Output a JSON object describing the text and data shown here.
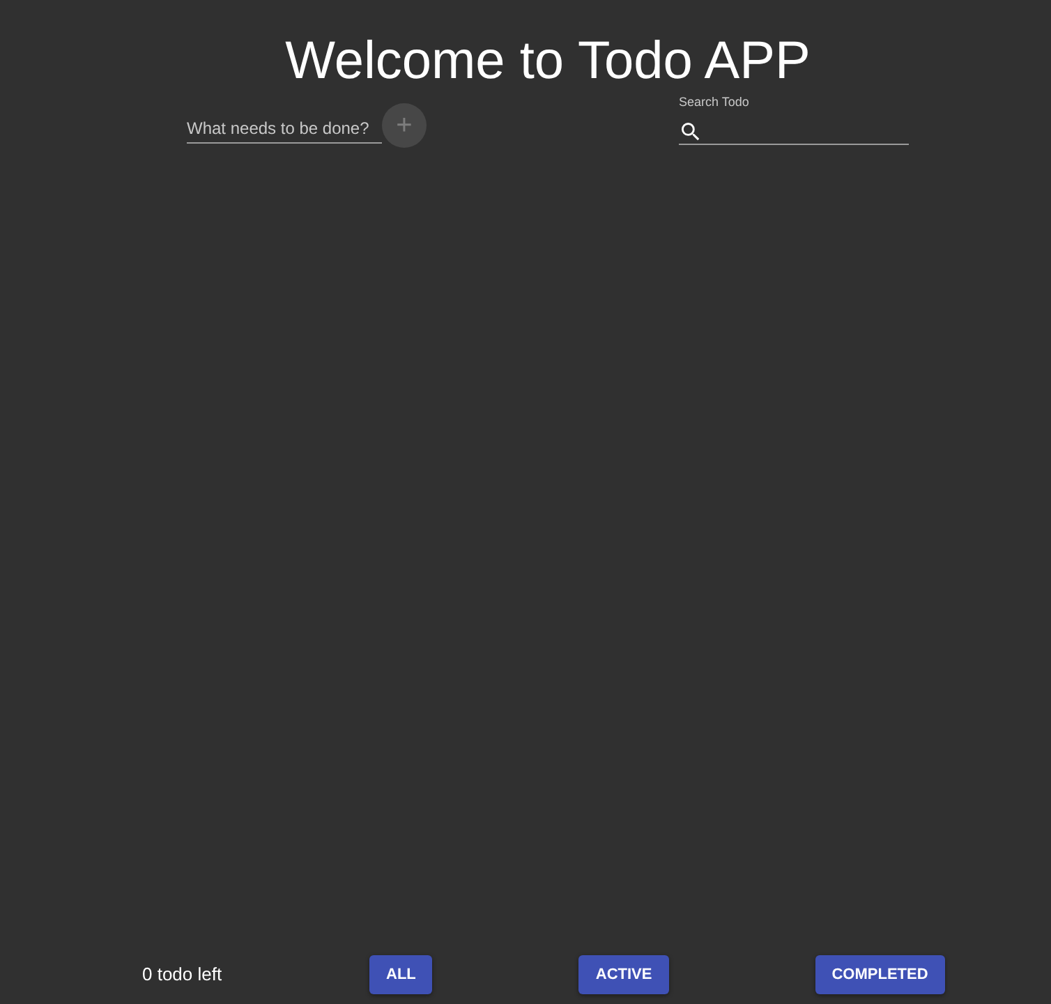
{
  "title": "Welcome to Todo APP",
  "new_todo": {
    "placeholder": "What needs to be done?",
    "add_button": "+"
  },
  "search": {
    "label": "Search Todo"
  },
  "footer": {
    "count": "0 todo left",
    "filters": [
      "ALL",
      "ACTIVE",
      "COMPLETED"
    ]
  }
}
